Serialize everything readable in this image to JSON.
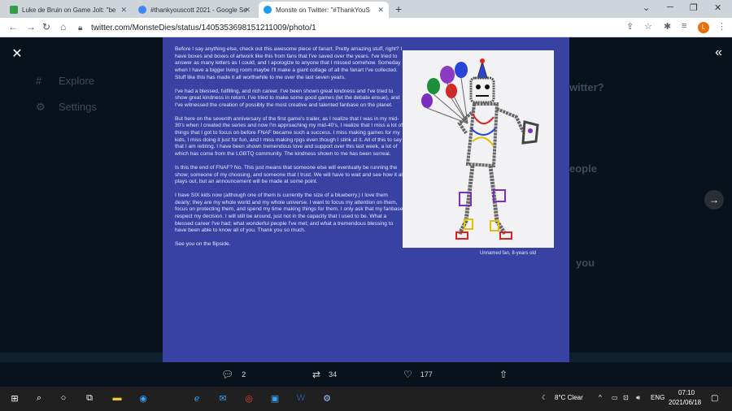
{
  "browser": {
    "tabs": [
      {
        "title": "Luke de Bruin on Game Jolt: \"be",
        "fav_color": "#2f9e44",
        "active": false
      },
      {
        "title": "#thankyouscott 2021 - Google Se",
        "fav_color": "#4285f4",
        "active": false
      },
      {
        "title": "Monste on Twitter: \"#ThankYouS",
        "fav_color": "#1d9bf0",
        "active": true
      }
    ],
    "new_tab": "+",
    "url": "twitter.com/MonsteDies/status/1405353698151211009/photo/1",
    "profile_initial": "L"
  },
  "background": {
    "explore": "Explore",
    "settings": "Settings",
    "twitter_q": "witter?",
    "people": "eople",
    "you": "you"
  },
  "letter": {
    "paragraphs": [
      "Before I say anything else, check out this awesome piece of fanart. Pretty amazing stuff, right? I have boxes and boxes of artwork like this from fans that I've saved over the years. I've tried to answer as many letters as I could, and I apologize to anyone that I missed somehow. Someday when I have a bigger living room maybe I'll make a giant collage of all the fanart I've collected. Stuff like this has made it all worthwhile to me over the last seven years.",
      "I've had a blessed, fulfilling, and rich career. I've been shown great kindness and I've tried to show great kindness in return. I've tried to make some good games (let the debate ensue), and I've witnessed the creation of possibly the most creative and talented fanbase on the planet.",
      "But here on the seventh anniversary of the first game's trailer, as I realize that I was in my mid-30's when I created the series and now I'm approaching my mid-40's, I realize that I miss a lot of things that I got to focus on before FNAF became such a success. I miss making games for my kids, I miss doing it just for fun, and I miss making rpgs even though I stink at it. All of this to say that I am retiring. I have been shown tremendous love and support over this last week, a lot of which has come from the LGBTQ community. The kindness shown to me has been surreal.",
      "Is this the end of FNAF? No. This just means that someone else will eventually be running the show; someone of my choosing, and someone that I trust. We will have to wait and see how it all plays out, but an announcement will be made at some point.",
      "I have SIX kids now (although one of them is currently the size of a blueberry.) I love them dearly; they are my whole world and my whole universe. I want to focus my attention on them, focus on protecting them, and spend my time making things for them. I only ask that my fanbase respect my decision. I will still be around, just not in the capacity that I used to be. What a blessed career I've had; what wonderful people I've met; and what a tremendous blessing to have been able to know all of you. Thank you so much.",
      "See you on the flipside."
    ],
    "caption": "Unnamed fan, 8-years old"
  },
  "actions": {
    "replies": "2",
    "retweets": "34",
    "likes": "177"
  },
  "taskbar": {
    "weather": "8°C  Clear",
    "lang": "ENG",
    "time": "07:10",
    "date": "2021/06/18"
  },
  "colors": {
    "photo_bg": "#3742a2",
    "accent": "#1d9bf0"
  }
}
